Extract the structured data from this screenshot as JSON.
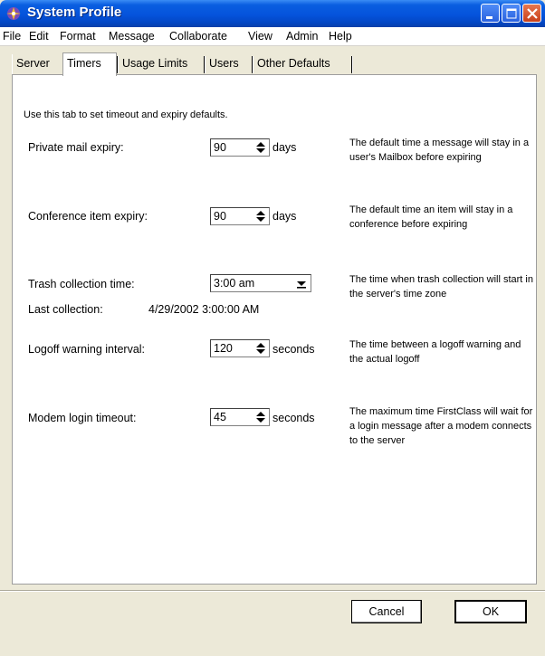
{
  "window": {
    "title": "System Profile",
    "icon": "firstclass-app-icon"
  },
  "menubar": {
    "items": [
      "File",
      "Edit",
      "Format",
      "Message",
      "Collaborate",
      "View",
      "Admin",
      "Help"
    ]
  },
  "tabs": {
    "items": [
      "Server",
      "Timers",
      "Usage Limits",
      "Users",
      "Other Defaults"
    ],
    "active": "Timers"
  },
  "content": {
    "intro": "Use this tab to set timeout and expiry defaults.",
    "private_mail": {
      "label": "Private mail expiry:",
      "value": "90",
      "unit": "days",
      "description": "The default time a message will stay in a user's Mailbox before expiring"
    },
    "conference_item": {
      "label": "Conference item expiry:",
      "value": "90",
      "unit": "days",
      "description": "The default time an item will stay in a conference before expiring"
    },
    "trash_collection": {
      "label": "Trash collection time:",
      "value": "3:00 am",
      "description": "The time when trash collection will start in the server's time zone",
      "last_label": "Last collection:",
      "last_value": "4/29/2002 3:00:00 AM"
    },
    "logoff_warning": {
      "label": "Logoff warning interval:",
      "value": "120",
      "unit": "seconds",
      "description": "The time between a logoff warning and the actual logoff"
    },
    "modem_login": {
      "label": "Modem login timeout:",
      "value": "45",
      "unit": "seconds",
      "description": "The maximum time FirstClass will wait for a login message after a modem connects to the server"
    }
  },
  "buttons": {
    "cancel": "Cancel",
    "ok": "OK"
  },
  "colors": {
    "titlebar": "#0553dc",
    "window_bg": "#ece9d8",
    "close_button": "#c8401b"
  }
}
